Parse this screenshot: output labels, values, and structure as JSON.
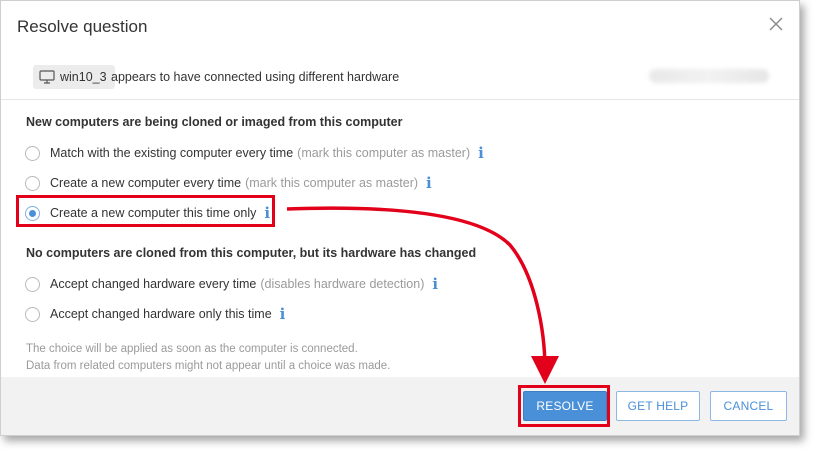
{
  "dialog": {
    "title": "Resolve question",
    "close_icon": "close-icon"
  },
  "header": {
    "computer_name": "win10_3",
    "computer_icon": "monitor-icon",
    "message": "appears to have connected using different hardware"
  },
  "sections": [
    {
      "title": "New computers are being cloned or imaged from this computer",
      "options": [
        {
          "label": "Match with the existing computer every time",
          "hint": "(mark this computer as master)",
          "selected": false
        },
        {
          "label": "Create a new computer every time",
          "hint": "(mark this computer as master)",
          "selected": false
        },
        {
          "label": "Create a new computer this time only",
          "hint": "",
          "selected": true
        }
      ]
    },
    {
      "title": "No computers are cloned from this computer, but its hardware has changed",
      "options": [
        {
          "label": "Accept changed hardware every time",
          "hint": "(disables hardware detection)",
          "selected": false
        },
        {
          "label": "Accept changed hardware only this time",
          "hint": "",
          "selected": false
        }
      ]
    }
  ],
  "note": {
    "line1": "The choice will be applied as soon as the computer is connected.",
    "line2": "Data from related computers might not appear until a choice was made."
  },
  "buttons": {
    "resolve": "RESOLVE",
    "get_help": "GET HELP",
    "cancel": "CANCEL"
  },
  "colors": {
    "accent": "#4a90d9",
    "annotation": "#e2001a"
  }
}
